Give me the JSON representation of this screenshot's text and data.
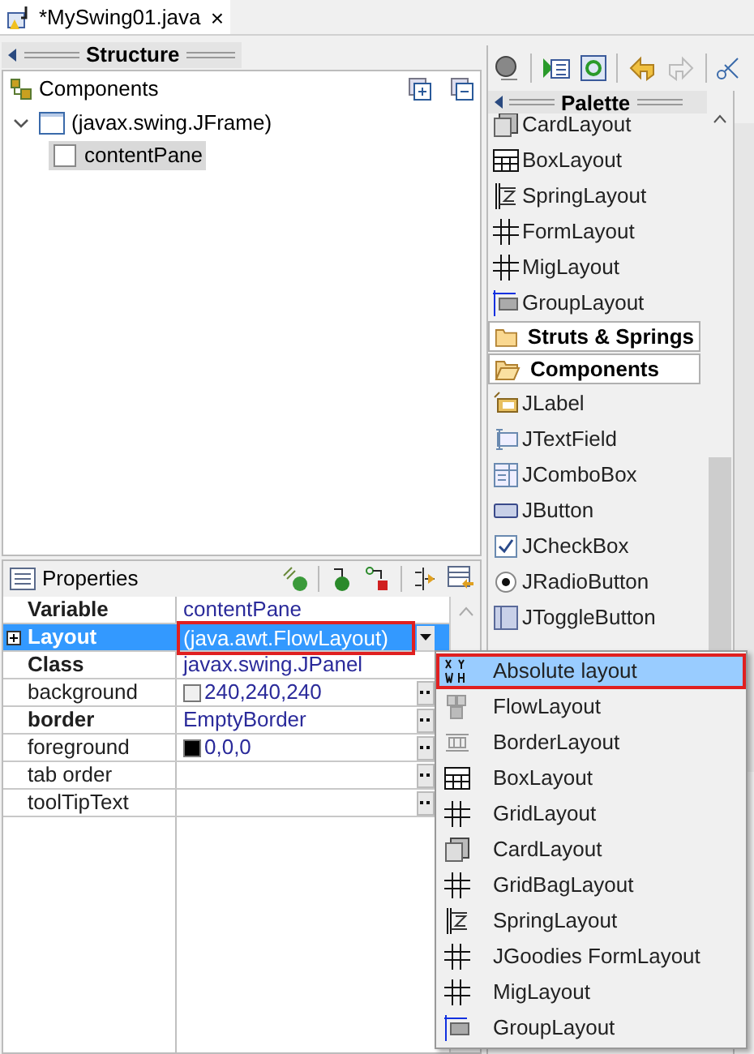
{
  "editor_tab": {
    "title": "*MySwing01.java",
    "close": "×"
  },
  "structure": {
    "title": "Structure",
    "components_label": "Components",
    "tree": [
      {
        "label": "(javax.swing.JFrame)",
        "expanded": true,
        "selected": false,
        "children": [
          {
            "label": "contentPane",
            "selected": true
          }
        ]
      }
    ]
  },
  "properties": {
    "title": "Properties",
    "rows": [
      {
        "name": "Variable",
        "bold": true,
        "value": "contentPane",
        "selected": false,
        "highlighted": false,
        "has_button": false
      },
      {
        "name": "Layout",
        "bold": true,
        "expandable": true,
        "value": "(java.awt.FlowLayout)",
        "selected": true,
        "highlighted": true,
        "dropdown": true
      },
      {
        "name": "Class",
        "bold": true,
        "value": "javax.swing.JPanel",
        "selected": false,
        "highlighted": false,
        "has_button": false
      },
      {
        "name": "background",
        "bold": false,
        "value": "240,240,240",
        "color": "#f0f0f0",
        "selected": false,
        "highlighted": false,
        "has_button": true
      },
      {
        "name": "border",
        "bold": true,
        "value": "EmptyBorder",
        "selected": false,
        "highlighted": false,
        "has_button": true
      },
      {
        "name": "foreground",
        "bold": false,
        "value": "0,0,0",
        "color": "#000000",
        "selected": false,
        "highlighted": false,
        "has_button": true
      },
      {
        "name": "tab order",
        "bold": false,
        "selected": false,
        "highlighted": false,
        "has_button": true
      },
      {
        "name": "toolTipText",
        "bold": false,
        "selected": false,
        "highlighted": false,
        "has_button": true
      }
    ]
  },
  "palette": {
    "title": "Palette",
    "items": [
      {
        "kind": "item",
        "label": "CardLayout"
      },
      {
        "kind": "item",
        "label": "BoxLayout"
      },
      {
        "kind": "item",
        "label": "SpringLayout"
      },
      {
        "kind": "item",
        "label": "FormLayout"
      },
      {
        "kind": "item",
        "label": "MigLayout"
      },
      {
        "kind": "item",
        "label": "GroupLayout"
      },
      {
        "kind": "category",
        "label": "Struts & Springs",
        "expanded": false
      },
      {
        "kind": "category",
        "label": "Components",
        "expanded": true
      },
      {
        "kind": "item",
        "label": "JLabel"
      },
      {
        "kind": "item",
        "label": "JTextField"
      },
      {
        "kind": "item",
        "label": "JComboBox"
      },
      {
        "kind": "item",
        "label": "JButton"
      },
      {
        "kind": "item",
        "label": "JCheckBox"
      },
      {
        "kind": "item",
        "label": "JRadioButton"
      },
      {
        "kind": "item",
        "label": "JToggleButton"
      }
    ]
  },
  "layout_menu": {
    "items": [
      {
        "label": "Absolute layout",
        "selected": true,
        "highlighted": true
      },
      {
        "label": "FlowLayout",
        "selected": false,
        "highlighted": false
      },
      {
        "label": "BorderLayout",
        "selected": false,
        "highlighted": false
      },
      {
        "label": "BoxLayout",
        "selected": false,
        "highlighted": false
      },
      {
        "label": "GridLayout",
        "selected": false,
        "highlighted": false
      },
      {
        "label": "CardLayout",
        "selected": false,
        "highlighted": false
      },
      {
        "label": "GridBagLayout",
        "selected": false,
        "highlighted": false
      },
      {
        "label": "SpringLayout",
        "selected": false,
        "highlighted": false
      },
      {
        "label": "JGoodies FormLayout",
        "selected": false,
        "highlighted": false
      },
      {
        "label": "MigLayout",
        "selected": false,
        "highlighted": false
      },
      {
        "label": "GroupLayout",
        "selected": false,
        "highlighted": false
      }
    ]
  }
}
